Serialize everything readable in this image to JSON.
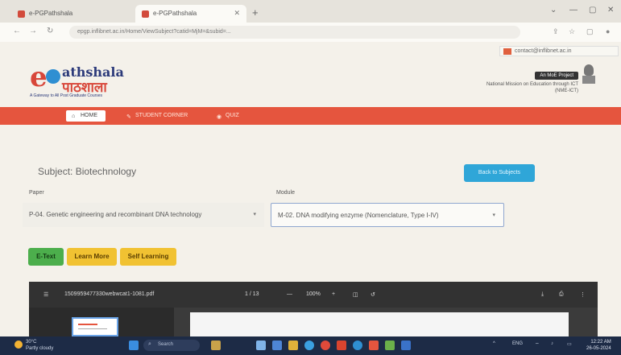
{
  "browser": {
    "tabs": [
      {
        "title": "e-PGPathshala",
        "active": false
      },
      {
        "title": "e-PGPathshala",
        "active": true
      }
    ],
    "new_tab_label": "+",
    "url": "epgp.inflibnet.ac.in/Home/ViewSubject?catid=MjM=&subid=...",
    "window_controls": [
      "⌄",
      "—",
      "▢",
      "✕"
    ]
  },
  "header": {
    "contact_email": "contact@inflibnet.ac.in",
    "logo": {
      "english": "athshala",
      "hindi": "पाठशाला",
      "tagline": "A Gateway to All Post Graduate Courses"
    },
    "mhrd_badge": "An MoE Project",
    "ministry_line": "National Mission on Education through ICT",
    "ministry_abbr": "(NME-ICT)"
  },
  "nav": {
    "items": [
      {
        "label": "HOME",
        "icon": "home-icon"
      },
      {
        "label": "STUDENT CORNER",
        "icon": "student-icon"
      },
      {
        "label": "QUIZ",
        "icon": "quiz-icon"
      }
    ]
  },
  "main": {
    "subject_label": "Subject: Biotechnology",
    "back_button": "Back to Subjects",
    "paper_label": "Paper",
    "paper_value": "P-04. Genetic engineering and recombinant DNA technology",
    "module_label": "Module",
    "module_value": "M-02. DNA modifying enzyme (Nomenclature, Type I-IV)",
    "buttons": {
      "etext": "E-Text",
      "learn_more": "Learn More",
      "self_learning": "Self Learning"
    }
  },
  "pdf": {
    "filename": "1509959477330webwcat1-1081.pdf",
    "page_indicator": "1 / 13",
    "zoom": "100%",
    "zoom_out": "—",
    "zoom_in": "+"
  },
  "taskbar": {
    "weather_temp": "30°C",
    "weather_desc": "Partly cloudy",
    "search_label": "Search",
    "language": "ENG",
    "time": "12:22 AM",
    "date": "26-05-2024"
  },
  "colors": {
    "brand_red": "#e5553e",
    "accent_blue": "#2fa6d8",
    "etext_green": "#4cae4c",
    "yellow_button": "#f1c232",
    "taskbar": "#1d2b46"
  }
}
